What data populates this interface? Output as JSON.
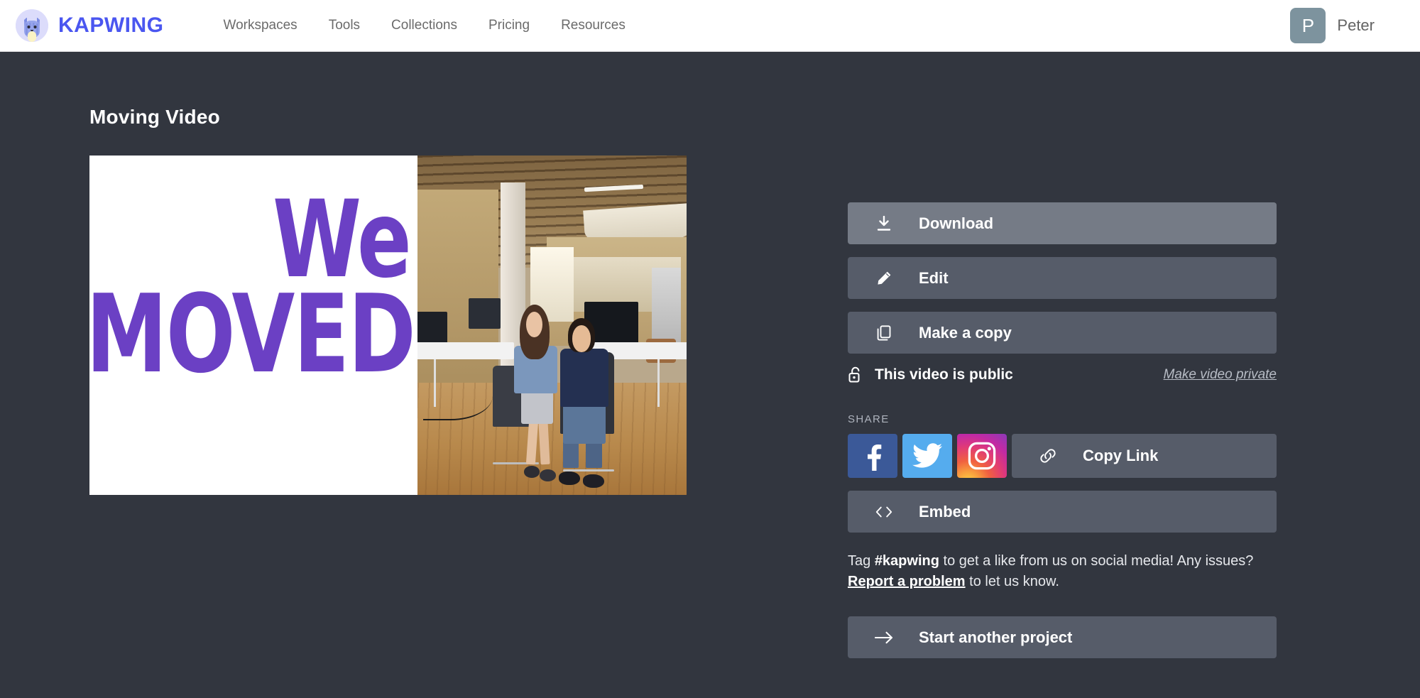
{
  "header": {
    "brand_name": "KAPWING",
    "brand_icon": "cat-logo-icon",
    "nav": [
      {
        "label": "Workspaces"
      },
      {
        "label": "Tools"
      },
      {
        "label": "Collections"
      },
      {
        "label": "Pricing"
      },
      {
        "label": "Resources"
      }
    ],
    "user": {
      "initial": "P",
      "name": "Peter"
    }
  },
  "main": {
    "project_title": "Moving Video",
    "video_preview": {
      "overlay_line1": "We",
      "overlay_line2": "MOVED",
      "overlay_color": "#6b40c4",
      "background_color": "#ffffff",
      "photo_description": "Office interior with two people seated"
    }
  },
  "actions": {
    "download": {
      "label": "Download",
      "icon": "download-icon",
      "state": "hovered"
    },
    "edit": {
      "label": "Edit",
      "icon": "pencil-icon"
    },
    "make_copy": {
      "label": "Make a copy",
      "icon": "copy-icon"
    },
    "start_another": {
      "label": "Start another project",
      "icon": "arrow-right-icon"
    }
  },
  "privacy": {
    "icon": "unlock-icon",
    "status_text": "This video is public",
    "toggle_link": "Make video private"
  },
  "share": {
    "section_label": "SHARE",
    "facebook": {
      "name": "facebook-icon",
      "color": "#3b5998"
    },
    "twitter": {
      "name": "twitter-icon",
      "color": "#55acee"
    },
    "instagram": {
      "name": "instagram-icon",
      "color": "#c32aa3"
    },
    "copy_link": {
      "label": "Copy Link",
      "icon": "link-icon"
    },
    "embed": {
      "label": "Embed",
      "icon": "code-brackets-icon"
    }
  },
  "tagline": {
    "part1": "Tag ",
    "hashtag": "#kapwing",
    "part2": " to get a like from us on social media! Any issues? ",
    "report_link": "Report a problem",
    "part3": " to let us know."
  },
  "colors": {
    "page_background": "#32363f",
    "button": "#565c69",
    "button_hover": "#757b86",
    "brand": "#4a56f0",
    "header_background": "#ffffff"
  }
}
